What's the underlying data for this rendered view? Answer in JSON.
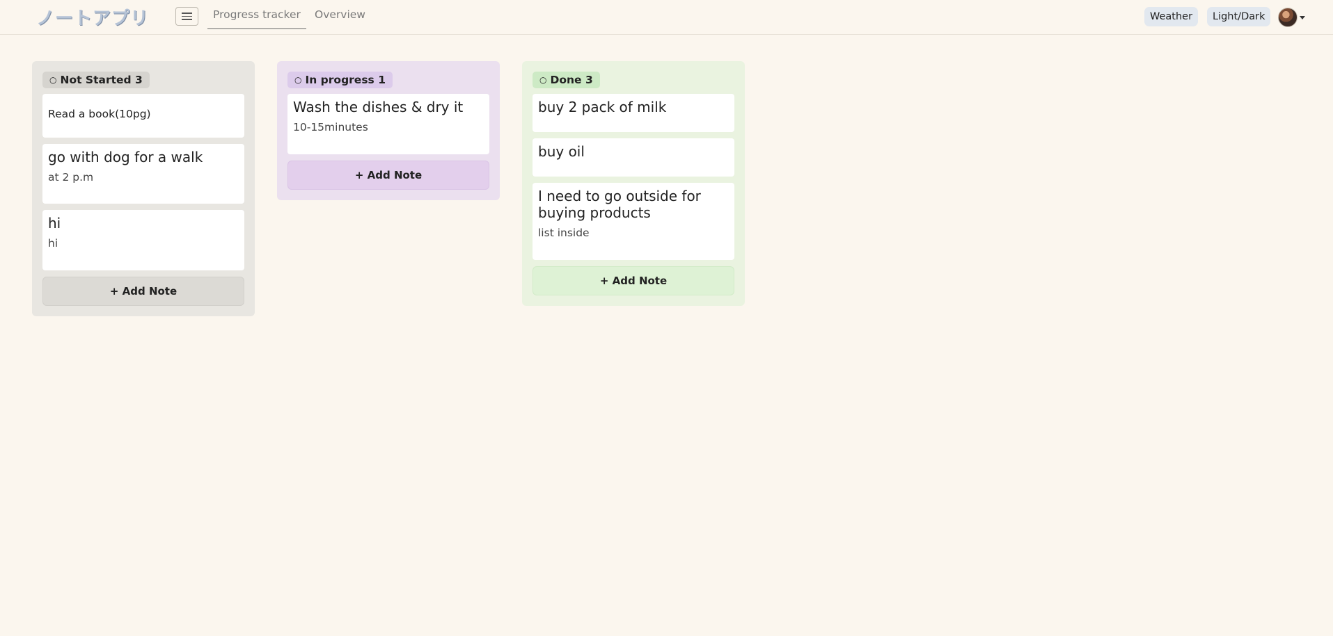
{
  "app": {
    "logo_text": "ノートアプリ"
  },
  "nav": {
    "tabs": [
      {
        "label": "Progress tracker",
        "active": true
      },
      {
        "label": "Overview",
        "active": false
      }
    ]
  },
  "header_actions": {
    "weather_label": "Weather",
    "theme_label": "Light/Dark"
  },
  "board": {
    "add_note_label": "+ Add Note",
    "columns": [
      {
        "status_icon": "○",
        "title": "Not Started",
        "count": "3",
        "color": "#e8e6e1",
        "cards": [
          {
            "title": "Read a book(10pg)",
            "body": ""
          },
          {
            "title": "go with dog for a walk",
            "body": "at 2 p.m"
          },
          {
            "title": "hi",
            "body": "hi"
          }
        ]
      },
      {
        "status_icon": "○",
        "title": "In progress",
        "count": "1",
        "color": "#ebe0ef",
        "cards": [
          {
            "title": "Wash the dishes & dry it",
            "body": "10-15minutes"
          }
        ]
      },
      {
        "status_icon": "○",
        "title": "Done",
        "count": "3",
        "color": "#eaf3e0",
        "cards": [
          {
            "title": "buy 2 pack of milk",
            "body": ""
          },
          {
            "title": "buy oil",
            "body": ""
          },
          {
            "title": "I need to go outside for buying products",
            "body": "list inside"
          }
        ]
      }
    ]
  }
}
